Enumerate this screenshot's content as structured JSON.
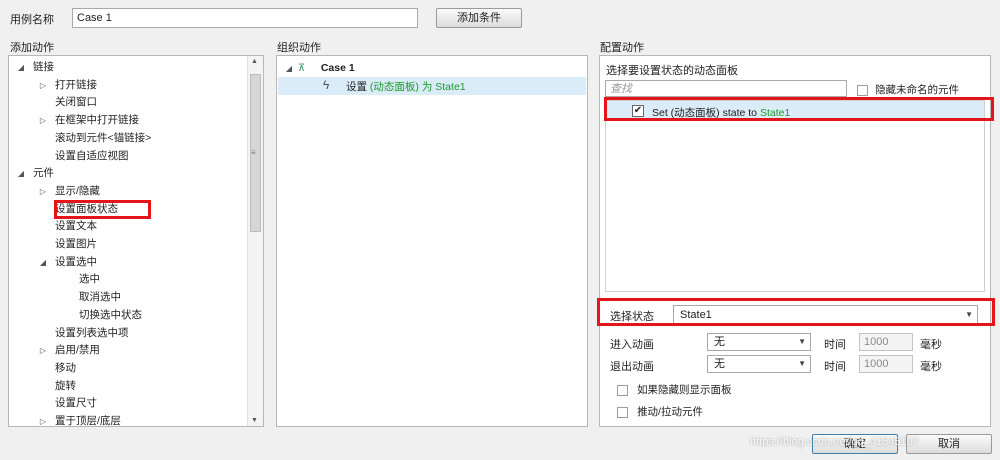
{
  "case_name": {
    "label": "用例名称",
    "value": "Case 1"
  },
  "add_condition_label": "添加条件",
  "add_action": {
    "title": "添加动作",
    "tree": [
      {
        "label": "链接",
        "arrow": "◢"
      },
      {
        "label": "打开链接",
        "arrow": "▷"
      },
      {
        "label": "关闭窗口",
        "arrow": ""
      },
      {
        "label": "在框架中打开链接",
        "arrow": "▷"
      },
      {
        "label": "滚动到元件<锚链接>",
        "arrow": ""
      },
      {
        "label": "设置自适应视图",
        "arrow": ""
      },
      {
        "label": "元件",
        "arrow": "◢"
      },
      {
        "label": "显示/隐藏",
        "arrow": "▷"
      },
      {
        "label": "设置面板状态",
        "arrow": ""
      },
      {
        "label": "设置文本",
        "arrow": ""
      },
      {
        "label": "设置图片",
        "arrow": ""
      },
      {
        "label": "设置选中",
        "arrow": "◢"
      },
      {
        "label": "选中",
        "arrow": ""
      },
      {
        "label": "取消选中",
        "arrow": ""
      },
      {
        "label": "切换选中状态",
        "arrow": ""
      },
      {
        "label": "设置列表选中项",
        "arrow": ""
      },
      {
        "label": "启用/禁用",
        "arrow": "▷"
      },
      {
        "label": "移动",
        "arrow": ""
      },
      {
        "label": "旋转",
        "arrow": ""
      },
      {
        "label": "设置尺寸",
        "arrow": ""
      },
      {
        "label": "置于顶层/底层",
        "arrow": "▷"
      }
    ]
  },
  "organize": {
    "title": "组织动作",
    "case_label": "Case 1",
    "action_prefix": "设置",
    "action_target": "(动态面板)",
    "action_mid": "为",
    "action_state": "State1"
  },
  "configure": {
    "title": "配置动作",
    "subtitle": "选择要设置状态的动态面板",
    "search_placeholder": "查找",
    "hide_unnamed": "隐藏未命名的元件",
    "item_prefix": "Set (动态面板) state to",
    "item_state": "State1",
    "select_state_label": "选择状态",
    "select_state_value": "State1",
    "enter_anim_label": "进入动画",
    "enter_anim_value": "无",
    "exit_anim_label": "退出动画",
    "exit_anim_value": "无",
    "time_label": "时间",
    "enter_time": "1000",
    "exit_time": "1000",
    "ms_label": "毫秒",
    "show_if_hidden": "如果隐藏则显示面板",
    "push_pull": "推动/拉动元件"
  },
  "footer": {
    "ok": "确定",
    "cancel": "取消",
    "watermark": "https://blog.csdn.net/qq_41545107"
  },
  "colors": {
    "highlight_red": "#e3151a",
    "state_green": "#1a9b2b",
    "selected_row": "#d9ecf7"
  }
}
